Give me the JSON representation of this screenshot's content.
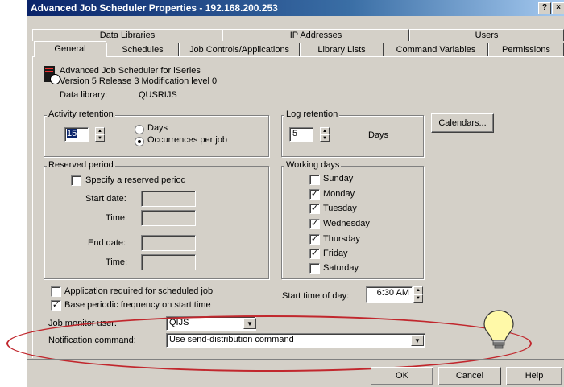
{
  "window": {
    "title": "Advanced Job Scheduler Properties - 192.168.200.253"
  },
  "tabs": {
    "row1": [
      "Data Libraries",
      "IP Addresses",
      "Users"
    ],
    "row2": [
      "General",
      "Schedules",
      "Job Controls/Applications",
      "Library Lists",
      "Command Variables",
      "Permissions"
    ],
    "active": "General"
  },
  "product": {
    "name": "Advanced Job Scheduler for iSeries",
    "version": "Version 5 Release 3 Modification level 0",
    "data_library_label": "Data library:",
    "data_library_value": "QUSRIJS"
  },
  "activity_retention": {
    "legend": "Activity retention",
    "value": "15",
    "days_label": "Days",
    "occurrences_label": "Occurrences per job",
    "selected": "Occurrences per job"
  },
  "log_retention": {
    "legend": "Log retention",
    "value": "5",
    "unit_label": "Days"
  },
  "calendars_button": "Calendars...",
  "reserved_period": {
    "legend": "Reserved period",
    "specify_label": "Specify a reserved period",
    "specify_checked": false,
    "start_date_label": "Start date:",
    "start_time_label": "Time:",
    "end_date_label": "End date:",
    "end_time_label": "Time:"
  },
  "working_days": {
    "legend": "Working days",
    "days": [
      {
        "label": "Sunday",
        "checked": false
      },
      {
        "label": "Monday",
        "checked": true
      },
      {
        "label": "Tuesday",
        "checked": true
      },
      {
        "label": "Wednesday",
        "checked": true
      },
      {
        "label": "Thursday",
        "checked": true
      },
      {
        "label": "Friday",
        "checked": true
      },
      {
        "label": "Saturday",
        "checked": false
      }
    ]
  },
  "options": {
    "app_required_label": "Application required for scheduled job",
    "app_required_checked": false,
    "base_periodic_label": "Base periodic frequency on start time",
    "base_periodic_checked": true
  },
  "start_time": {
    "label": "Start time of day:",
    "value": "6:30 AM"
  },
  "job_monitor": {
    "label": "Job monitor user:",
    "value": "QIJS"
  },
  "notification": {
    "label": "Notification command:",
    "value": "Use send-distribution command"
  },
  "buttons": {
    "ok": "OK",
    "cancel": "Cancel",
    "help": "Help"
  },
  "colors": {
    "titlebar": "#0a246a",
    "dialog": "#d4d0c8",
    "highlight": "#c1272d",
    "bulb": "#fff9a8"
  },
  "icons": {
    "title_help": "question-mark",
    "title_close": "close-x",
    "product": "scheduler-clock",
    "tip": "lightbulb"
  }
}
